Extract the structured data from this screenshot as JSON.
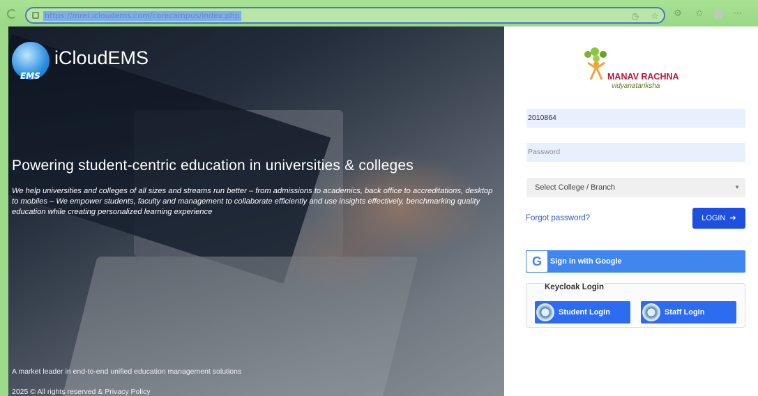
{
  "browser": {
    "url": "https://mrei.icloudems.com/corecampus/index.php"
  },
  "hero": {
    "brand": "iCloudEMS",
    "logo_text": "EMS",
    "headline": "Powering student-centric education in universities & colleges",
    "description": "We help universities and colleges of all sizes and streams run better – from admissions to academics, back office to accreditations, desktop to mobiles – We empower students, faculty and management to collaborate efficiently and use insights effectively, benchmarking quality education while creating personalized learning experience",
    "tagline": "A market leader in end-to-end unified education management solutions",
    "copyright": "2025 © All rights reserved & Privacy Policy"
  },
  "login": {
    "institution_name": "MANAV RACHNA",
    "institution_sub": "vidyanatariksha",
    "username_value": "2010864",
    "password_placeholder": "Password",
    "select_label": "Select College / Branch",
    "forgot_label": "Forgot password?",
    "login_label": "LOGIN",
    "google_label": "Sign in with Google",
    "keycloak_title": "Keycloak Login",
    "student_login_label": "Student Login",
    "staff_login_label": "Staff Login"
  }
}
